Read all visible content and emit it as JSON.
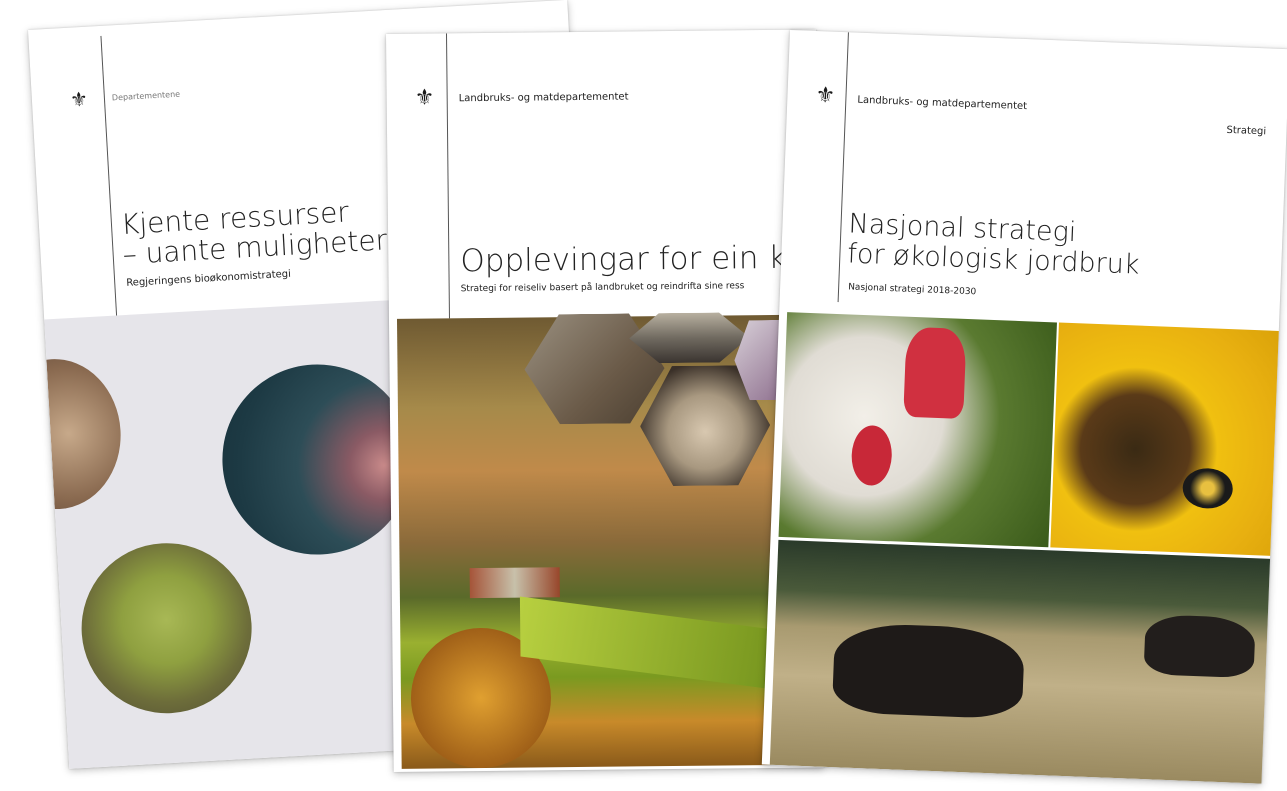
{
  "covers": [
    {
      "department": "Departementene",
      "title_line1": "Kjente ressurser",
      "title_line2": "– uante muligheter",
      "subtitle": "Regjeringens bioøkonomistrategi"
    },
    {
      "department": "Landbruks- og matdepartementet",
      "title": "Opplevingar for ein kvar",
      "subtitle": "Strategi for reiseliv basert på landbruket og reindrifta sine ress"
    },
    {
      "department": "Landbruks- og matdepartementet",
      "label": "Strategi",
      "title_line1": "Nasjonal strategi",
      "title_line2": "for økologisk jordbruk",
      "subtitle": "Nasjonal strategi 2018-2030"
    }
  ]
}
